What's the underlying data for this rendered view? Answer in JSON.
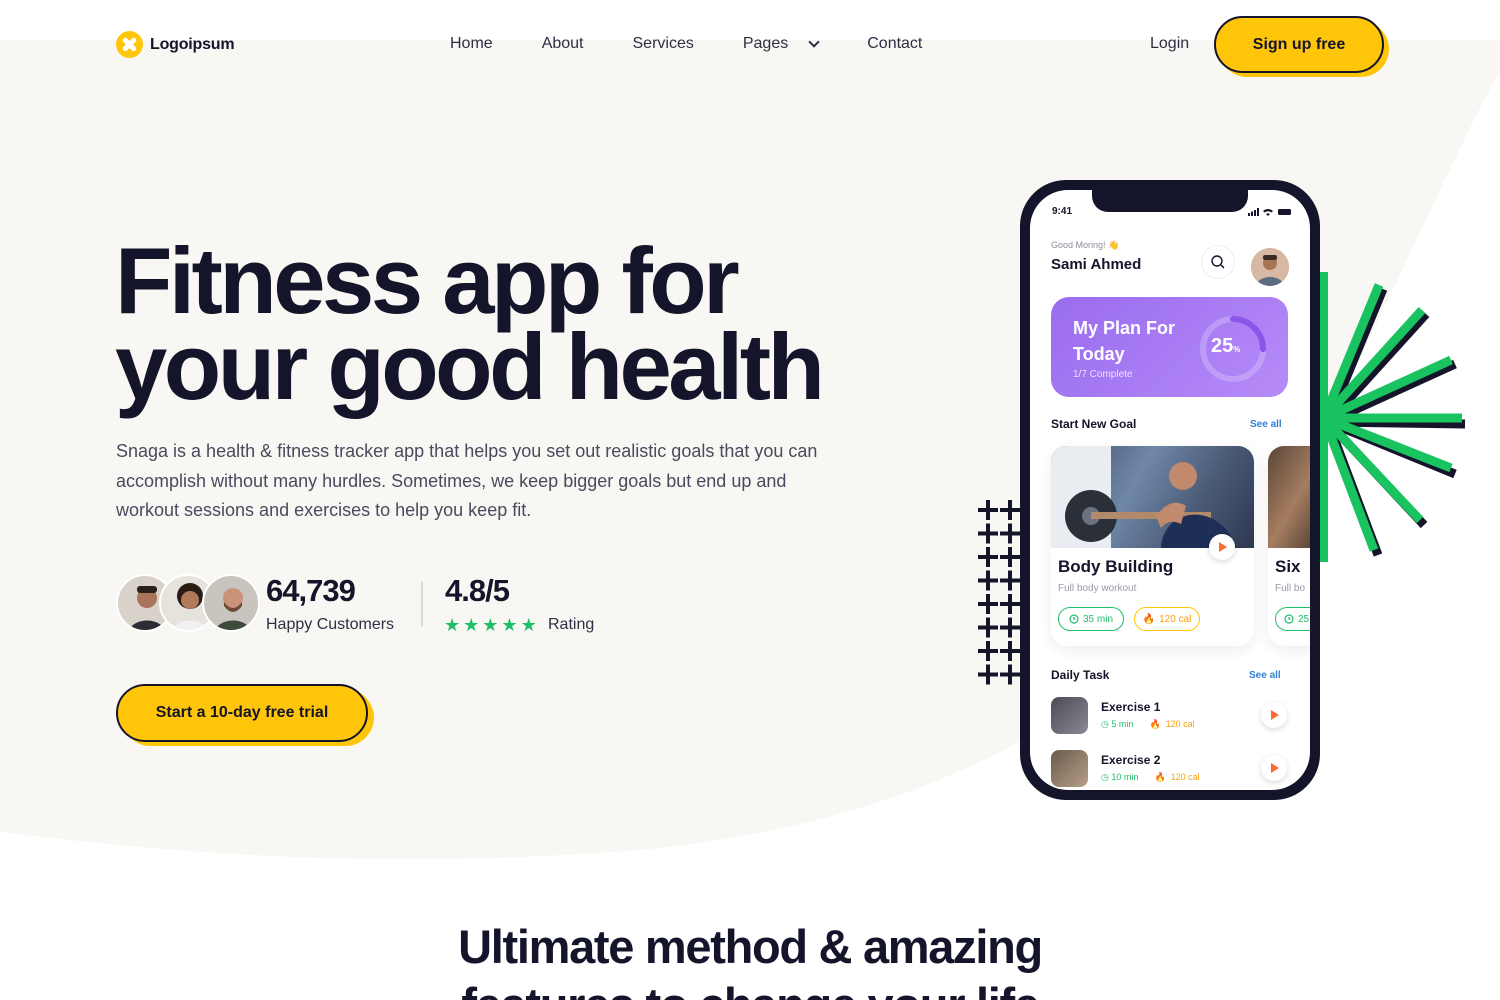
{
  "nav": {
    "logo_text": "Logoipsum",
    "menu": [
      "Home",
      "About",
      "Services",
      "Pages",
      "Contact"
    ],
    "login": "Login",
    "signup": "Sign up free"
  },
  "hero": {
    "title_line1": "Fitness app for",
    "title_line2": "your good health",
    "description": "Snaga is a health & fitness tracker app that helps you set out realistic goals that you can accomplish without many hurdles. Sometimes, we keep bigger goals but end up and workout sessions and exercises to help you keep fit.",
    "customers_count": "64,739",
    "customers_label": "Happy Customers",
    "rating_value": "4.8/5",
    "rating_label": "Rating",
    "rating_stars": 5,
    "cta": "Start a 10-day free trial"
  },
  "section": {
    "title_line1": "Ultimate method & amazing",
    "title_line2": "features to change your life"
  },
  "phone": {
    "time": "9:41",
    "greeting": "Good Moring! 👋",
    "user_name": "Sami Ahmed",
    "plan": {
      "title": "My Plan For Today",
      "subtitle": "1/7 Complete",
      "percent": "25",
      "percent_suffix": "%",
      "progress_fraction": 0.25
    },
    "goals_heading": "Start New Goal",
    "goals_see_all": "See all",
    "goals": [
      {
        "name": "Body Building",
        "subtitle": "Full body workout",
        "duration": "35 min",
        "calories": "120 cal"
      },
      {
        "name": "Six",
        "subtitle": "Full bo",
        "duration": "25"
      }
    ],
    "tasks_heading": "Daily Task",
    "tasks_see_all": "See all",
    "tasks": [
      {
        "name": "Exercise 1",
        "duration": "5 min",
        "calories": "120 cal"
      },
      {
        "name": "Exercise 2",
        "duration": "10 min",
        "calories": "120 cal"
      }
    ]
  },
  "colors": {
    "accent_yellow": "#ffc609",
    "dark": "#14142b",
    "green": "#1fbf6a",
    "purple": "#9a6cf0",
    "orange": "#ff6b2c",
    "link_blue": "#2f7fd6"
  },
  "icons": [
    "logo-icon",
    "chevron-down-icon",
    "search-icon",
    "play-icon",
    "clock-icon",
    "fire-icon",
    "star-icon",
    "signal-icon",
    "wifi-icon",
    "battery-icon"
  ]
}
